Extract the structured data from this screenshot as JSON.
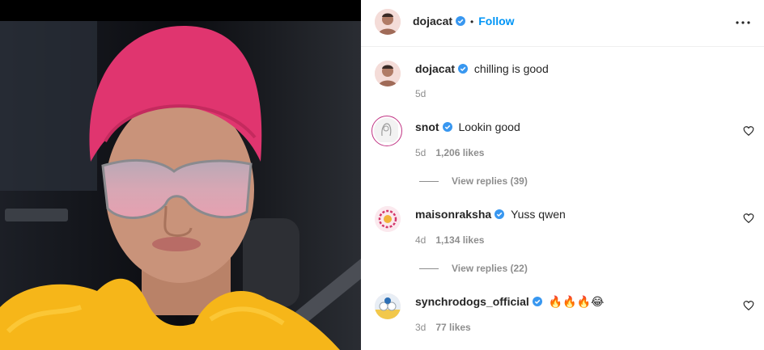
{
  "post": {
    "author": "dojacat",
    "follow_label": "Follow",
    "separator": "•",
    "caption": {
      "username": "dojacat",
      "text": "chilling is good",
      "time": "5d"
    }
  },
  "comments": [
    {
      "username": "snot",
      "text": "Lookin good",
      "time": "5d",
      "likes": "1,206 likes",
      "replies": "View replies (39)"
    },
    {
      "username": "maisonraksha",
      "text": "Yuss qwen",
      "time": "4d",
      "likes": "1,134 likes",
      "replies": "View replies (22)"
    },
    {
      "username": "synchrodogs_official",
      "text": "🔥🔥🔥😂",
      "time": "3d",
      "likes": "77 likes"
    }
  ],
  "colors": {
    "accent": "#0095f6",
    "verified": "#3897f0",
    "secondary_text": "#8e8e8e",
    "cap": "#e0356f",
    "fur": "#f6b619"
  },
  "icons": [
    "more-options-icon",
    "verified-badge-icon",
    "heart-icon"
  ]
}
